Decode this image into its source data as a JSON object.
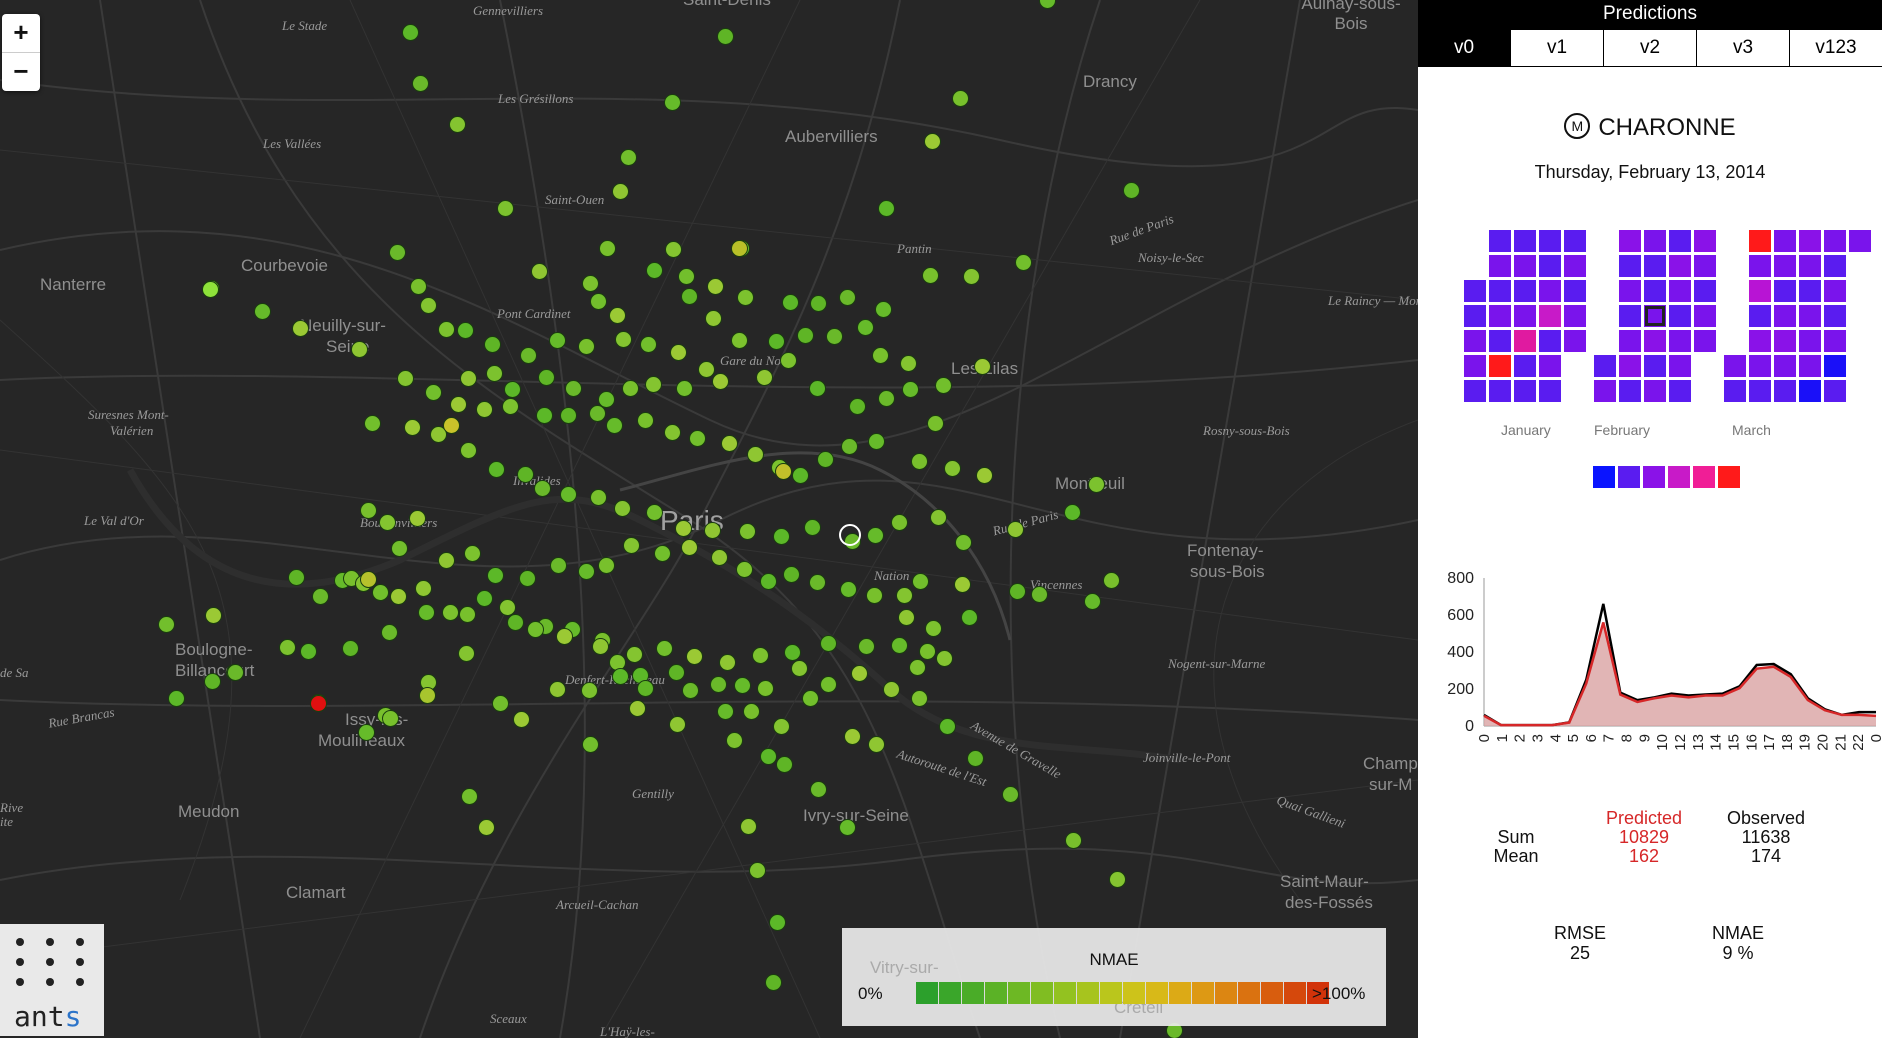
{
  "map": {
    "labels": {
      "stade": "Le Stade",
      "gennevilliers": "Gennevilliers",
      "saintdenis": "Saint-Denis",
      "aulnay": "Aulnay-sous-Bois",
      "gresillons": "Les Grésillons",
      "vallees": "Les Vallées",
      "aubervilliers": "Aubervilliers",
      "drancy": "Drancy",
      "saintouen": "Saint-Ouen",
      "courbevoie": "Courbevoie",
      "nanterre": "Nanterre",
      "neuilly1": "Neuilly-sur-",
      "neuilly2": "Seine",
      "pontcardinet": "Pont Cardinet",
      "pantin": "Pantin",
      "ruedeparis": "Rue de Paris",
      "noisy": "Noisy-le-Sec",
      "raincy": "Le Raincy — Montfe",
      "garedunord": "Gare du Nord",
      "lilas": "Les Lilas",
      "suresnes1": "Suresnes Mont-",
      "suresnes2": "Valérien",
      "rosny": "Rosny-sous-Bois",
      "invalides": "Invalides",
      "paris": "Paris",
      "montreuil": "Montreuil",
      "valdor": "Le Val d'Or",
      "boulainvilliers": "Boulainvilliers",
      "ruedeparis2": "Rue de Paris",
      "fontenay1": "Fontenay-",
      "fontenay2": "sous-Bois",
      "nation": "Nation",
      "vincennes": "Vincennes",
      "boulogne1": "Boulogne-",
      "boulogne2": "Billancourt",
      "desa": "de Sa",
      "ruebrancas": "Rue Brancas",
      "denfert": "Denfert-Rochereau",
      "nogent": "Nogent-sur-Marne",
      "issy1": "Issy-les-",
      "issy2": "Moulineaux",
      "avgravelle": "Avenue de Gravelle",
      "autoroute": "Autoroute de l'Est",
      "joinville": "Joinville-le-Pont",
      "champ1": "Champ",
      "champ2": "sur-M",
      "gentilly": "Gentilly",
      "ivry": "Ivry-sur-Seine",
      "meudon": "Meudon",
      "rive": "Rive",
      "ite": "ite",
      "quaigallieni": "Quai Gallieni",
      "saintmaur1": "Saint-Maur-",
      "saintmaur2": "des-Fossés",
      "clamart": "Clamart",
      "arcueil": "Arcueil-Cachan",
      "vitry": "Vitry-sur-",
      "sceaux": "Sceaux",
      "creteil": "Créteil",
      "hay": "L'Haÿ-les-"
    },
    "zoom_in": "+",
    "zoom_out": "−",
    "logo_text": "ant",
    "logo_text_accent": "s",
    "legend": {
      "title": "NMAE",
      "low": "0%",
      "high": ">100%"
    },
    "legend_colors": [
      "#2ca02c",
      "#3aa62a",
      "#4aac28",
      "#5bb226",
      "#6db824",
      "#80bd22",
      "#93c220",
      "#a7c41e",
      "#bac61c",
      "#cdc31a",
      "#d8b918",
      "#dcaa16",
      "#dd9914",
      "#dc8612",
      "#da7210",
      "#d85d0e",
      "#d5480c",
      "#d2330a"
    ]
  },
  "panel": {
    "title": "Predictions",
    "tabs": [
      "v0",
      "v1",
      "v2",
      "v3",
      "v123"
    ],
    "active_tab": 0,
    "station_icon": "metro-icon",
    "station_glyph": "M",
    "station": "CHARONNE",
    "date": "Thursday, February 13, 2014",
    "months": [
      "January",
      "February",
      "March"
    ],
    "calendar_scale": [
      "#0a14ff",
      "#5a1cf0",
      "#8a12e8",
      "#c81ac8",
      "#f01e96",
      "#ff1a1a"
    ],
    "calendar": {
      "January": {
        "start_weekday": 2,
        "colors": [
          "#5a1cf0",
          "#5a1cf0",
          "#7a14ec",
          "#7a14ec",
          "#5a1cf0",
          "#5a1cf0",
          "#7a14ec",
          "#5a1cf0",
          "#7a14ec",
          "#5a1cf0",
          "#ff1a1a",
          "#5a1cf0",
          "#5a1cf0",
          "#7a14ec",
          "#5a1cf0",
          "#7a14ec",
          "#e01aa0",
          "#5a1cf0",
          "#5a1cf0",
          "#5a1cf0",
          "#5a1cf0",
          "#7a14ec",
          "#c81ac8",
          "#5a1cf0",
          "#7a14ec",
          "#5a1cf0",
          "#5a1cf0",
          "#7a14ec",
          "#5a1cf0",
          "#7a14ec",
          "#7a14ec"
        ]
      },
      "February": {
        "start_weekday": 5,
        "colors": [
          "#5a1cf0",
          "#7a14ec",
          "#8a12e8",
          "#5a1cf0",
          "#7a14ec",
          "#5a1cf0",
          "#7a14ec",
          "#8a12e8",
          "#5a1cf0",
          "#7a14ec",
          "#5a1cf0",
          "#5a1cf0",
          "#7a14ec",
          "#8a12e8",
          "#5a1cf0",
          "#7a14ec",
          "#5a1cf0",
          "#8a12e8",
          "#7a14ec",
          "#5a1cf0",
          "#7a14ec",
          "#7a14ec",
          "#5a1cf0",
          "#8a12e8",
          "#7a14ec",
          "#5a1cf0",
          "#7a14ec",
          "#7a14ec"
        ],
        "selected_day": 13
      },
      "March": {
        "start_weekday": 5,
        "colors": [
          "#7a14ec",
          "#5a1cf0",
          "#ff1a1a",
          "#7a14ec",
          "#b814d4",
          "#5a1cf0",
          "#8a12e8",
          "#7a14ec",
          "#5a1cf0",
          "#7a14ec",
          "#7a14ec",
          "#5a1cf0",
          "#7a14ec",
          "#8a12e8",
          "#7a14ec",
          "#5a1cf0",
          "#8a12e8",
          "#7a14ec",
          "#5a1cf0",
          "#7a14ec",
          "#7a14ec",
          "#7a14ec",
          "#1a10f8",
          "#7a14ec",
          "#5a1cf0",
          "#7a14ec",
          "#5a1cf0",
          "#7a14ec",
          "#1a10f8",
          "#5a1cf0",
          "#7a14ec"
        ]
      }
    },
    "stats": {
      "predicted_label": "Predicted",
      "observed_label": "Observed",
      "sum_label": "Sum",
      "mean_label": "Mean",
      "predicted_sum": "10829",
      "predicted_mean": "162",
      "observed_sum": "11638",
      "observed_mean": "174",
      "rmse_label": "RMSE",
      "rmse": "25",
      "nmae_label": "NMAE",
      "nmae": "9 %"
    }
  },
  "chart_data": {
    "type": "area",
    "x": [
      0,
      1,
      2,
      3,
      4,
      5,
      6,
      7,
      8,
      9,
      10,
      11,
      12,
      13,
      14,
      15,
      16,
      17,
      18,
      19,
      20,
      21,
      22,
      23
    ],
    "xticks": [
      "0",
      "1",
      "2",
      "3",
      "4",
      "5",
      "6",
      "7",
      "8",
      "9",
      "10",
      "12",
      "13",
      "14",
      "15",
      "16",
      "17",
      "18",
      "19",
      "20",
      "21",
      "22",
      "0"
    ],
    "ylim": [
      0,
      800
    ],
    "yticks": [
      0,
      200,
      400,
      600,
      800
    ],
    "series": [
      {
        "name": "Observed",
        "color": "#000000",
        "values": [
          60,
          5,
          5,
          5,
          5,
          20,
          250,
          660,
          180,
          140,
          155,
          175,
          165,
          170,
          175,
          215,
          330,
          335,
          280,
          150,
          90,
          60,
          75,
          75
        ]
      },
      {
        "name": "Predicted",
        "color": "#d62728",
        "values": [
          55,
          5,
          5,
          5,
          5,
          18,
          230,
          560,
          170,
          130,
          150,
          165,
          155,
          165,
          165,
          205,
          310,
          320,
          265,
          140,
          85,
          60,
          60,
          55
        ]
      }
    ]
  }
}
